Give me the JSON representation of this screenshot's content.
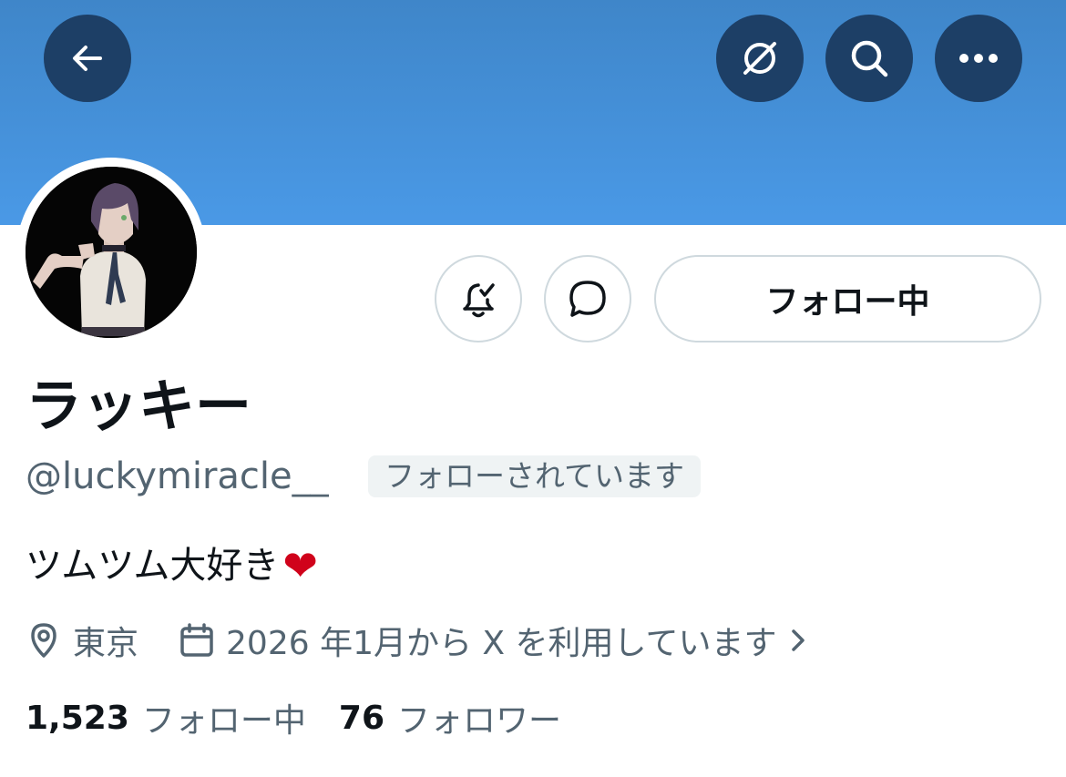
{
  "profile": {
    "display_name": "ラッキー",
    "handle": "@luckymiracle__",
    "follows_you": "フォローされています",
    "bio": "ツムツム大好き",
    "bio_emoji": "❤",
    "location": "東京",
    "joined": "2026 年1月から X を利用しています"
  },
  "actions": {
    "following_label": "フォロー中"
  },
  "stats": {
    "following_count": "1,523",
    "following_label": "フォロー中",
    "followers_count": "76",
    "followers_label": "フォロワー"
  },
  "colors": {
    "banner": "#4a99e6",
    "header_button": "#1d3f66",
    "secondary_text": "#536471",
    "border": "#cfd9de"
  },
  "icons": [
    "back-arrow-icon",
    "grok-icon",
    "search-icon",
    "more-icon",
    "notification-bell-icon",
    "message-icon",
    "location-pin-icon",
    "calendar-icon",
    "chevron-right-icon"
  ]
}
